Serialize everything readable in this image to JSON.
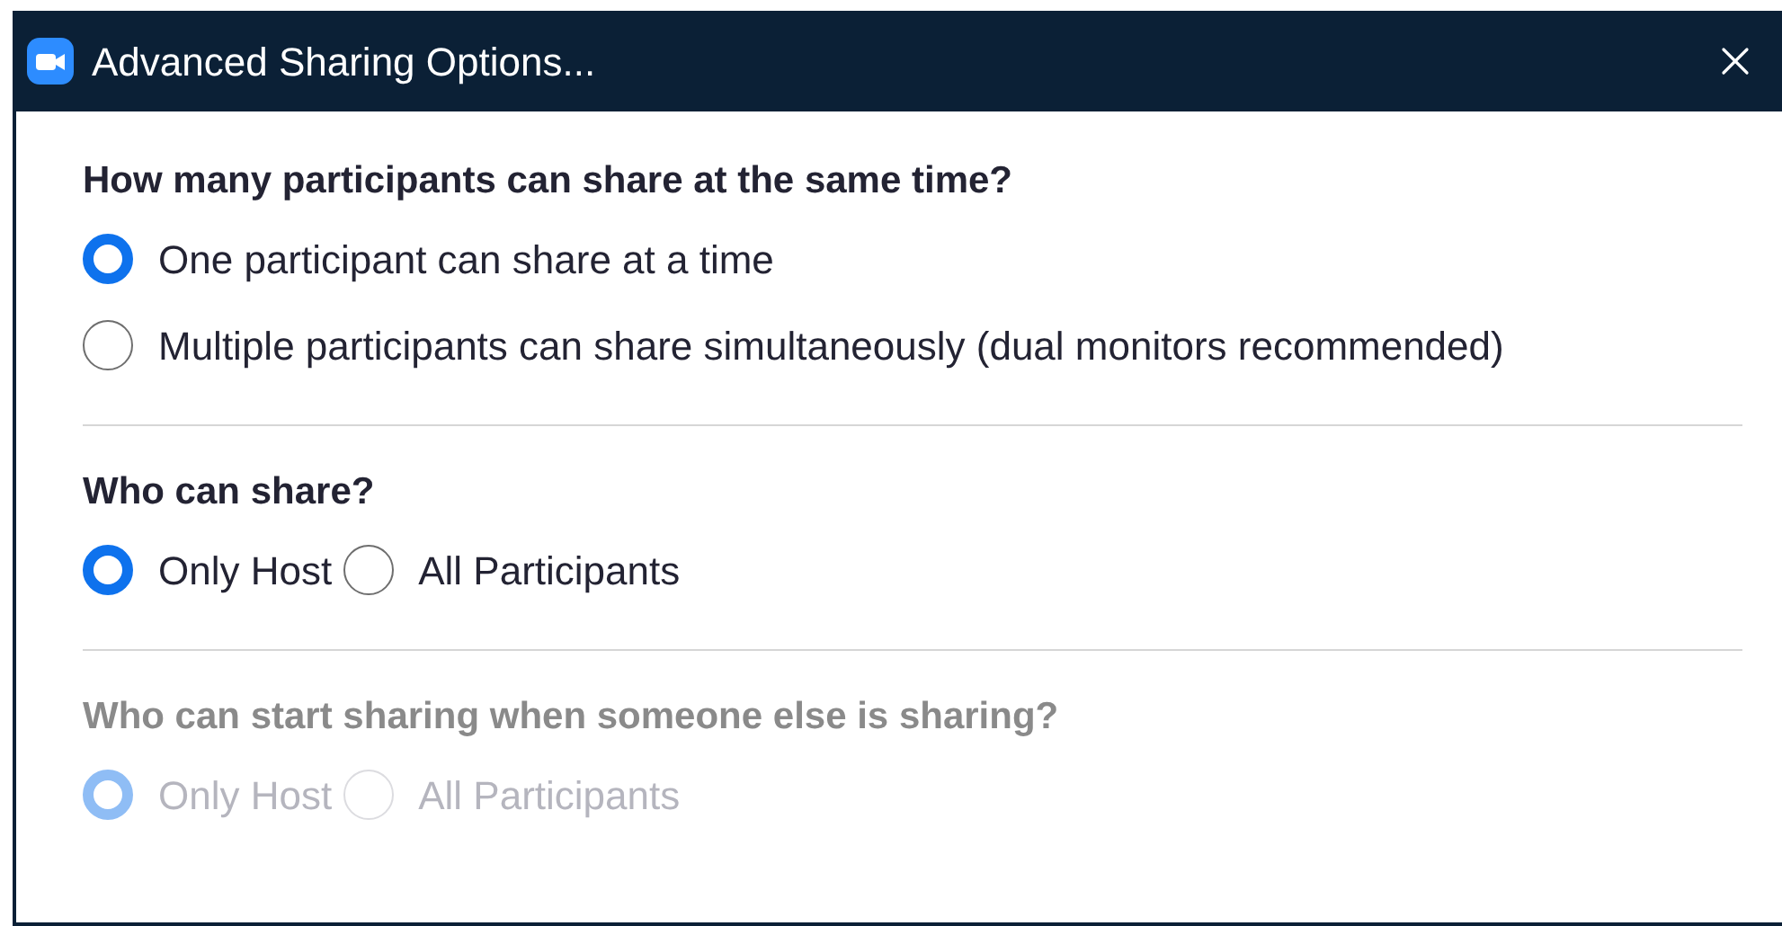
{
  "window": {
    "title": "Advanced Sharing Options..."
  },
  "sections": [
    {
      "question": "How many participants can share at the same time?",
      "disabled": false,
      "kind": "stacked",
      "options": [
        {
          "label": "One participant can share at a time",
          "selected": true
        },
        {
          "label": "Multiple participants can share simultaneously (dual monitors recommended)",
          "selected": false
        }
      ]
    },
    {
      "question": "Who can share?",
      "disabled": false,
      "kind": "inline",
      "options": [
        {
          "label": "Only Host",
          "selected": true
        },
        {
          "label": "All Participants",
          "selected": false
        }
      ]
    },
    {
      "question": "Who can start sharing when someone else is sharing?",
      "disabled": true,
      "kind": "inline",
      "options": [
        {
          "label": "Only Host",
          "selected": true
        },
        {
          "label": "All Participants",
          "selected": false
        }
      ]
    }
  ]
}
